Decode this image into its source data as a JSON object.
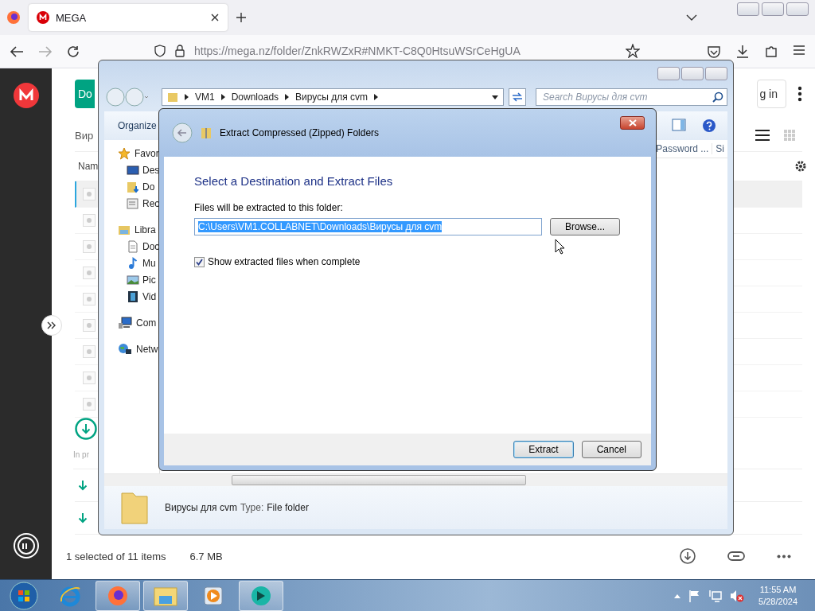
{
  "browser": {
    "tabs": [
      {
        "title": "MEGA",
        "selected": true
      }
    ],
    "address": "https://mega.nz/folder/ZnkRWZxR#NMKT-C8Q0HtsuWSrCeHgUA"
  },
  "mega": {
    "download_button": "Do",
    "login_button": "g in",
    "folder_title": "Вир",
    "name_header": "Nam",
    "rows": [
      {
        "selected": true
      },
      {
        "selected": false
      },
      {
        "selected": false
      },
      {
        "selected": false
      },
      {
        "selected": false
      },
      {
        "selected": false
      },
      {
        "selected": false
      },
      {
        "selected": false
      },
      {
        "selected": false
      }
    ],
    "in_progress": "In pr",
    "transfers": [
      {
        "kind": "download"
      },
      {
        "kind": "download"
      }
    ],
    "status": {
      "selection": "1 selected of 11 items",
      "size": "6.7 MB"
    }
  },
  "explorer": {
    "breadcrumb": [
      "VM1",
      "Downloads",
      "Вирусы для cvm"
    ],
    "search": {
      "placeholder": "Search Вирусы для cvm"
    },
    "organize": "Organize",
    "columns": [
      "Password ...",
      "Si"
    ],
    "nav": [
      {
        "label": "Favor",
        "kind": "favorites",
        "children": [
          {
            "label": "Des",
            "kind": "desktop"
          },
          {
            "label": "Do",
            "kind": "downloads"
          },
          {
            "label": "Rec",
            "kind": "recent"
          }
        ]
      },
      {
        "label": "Libra",
        "kind": "libraries",
        "children": [
          {
            "label": "Doc",
            "kind": "documents"
          },
          {
            "label": "Mu",
            "kind": "music"
          },
          {
            "label": "Pic",
            "kind": "pictures"
          },
          {
            "label": "Vid",
            "kind": "videos"
          }
        ]
      },
      {
        "label": "Com",
        "kind": "computer"
      },
      {
        "label": "Netw",
        "kind": "network"
      }
    ],
    "details": {
      "name": "Вирусы для cvm",
      "type_label": "Type:",
      "type_value": "File folder"
    }
  },
  "dialog": {
    "title": "Extract Compressed (Zipped) Folders",
    "heading": "Select a Destination and Extract Files",
    "path_label": "Files will be extracted to this folder:",
    "path_value": "C:\\Users\\VM1.COLLABNET\\Downloads\\Вирусы для cvm",
    "browse": "Browse...",
    "show_files": {
      "label": "Show extracted files when complete",
      "checked": true
    },
    "buttons": [
      {
        "label": "Extract",
        "default": true
      },
      {
        "label": "Cancel",
        "default": false
      }
    ]
  },
  "taskbar": {
    "apps": [
      {
        "kind": "ie",
        "active": false
      },
      {
        "kind": "firefox",
        "active": true
      },
      {
        "kind": "explorer",
        "active": true
      },
      {
        "kind": "media",
        "active": false
      },
      {
        "kind": "app",
        "active": true
      }
    ],
    "clock": {
      "time": "11:55 AM",
      "date": "5/28/2024"
    }
  }
}
